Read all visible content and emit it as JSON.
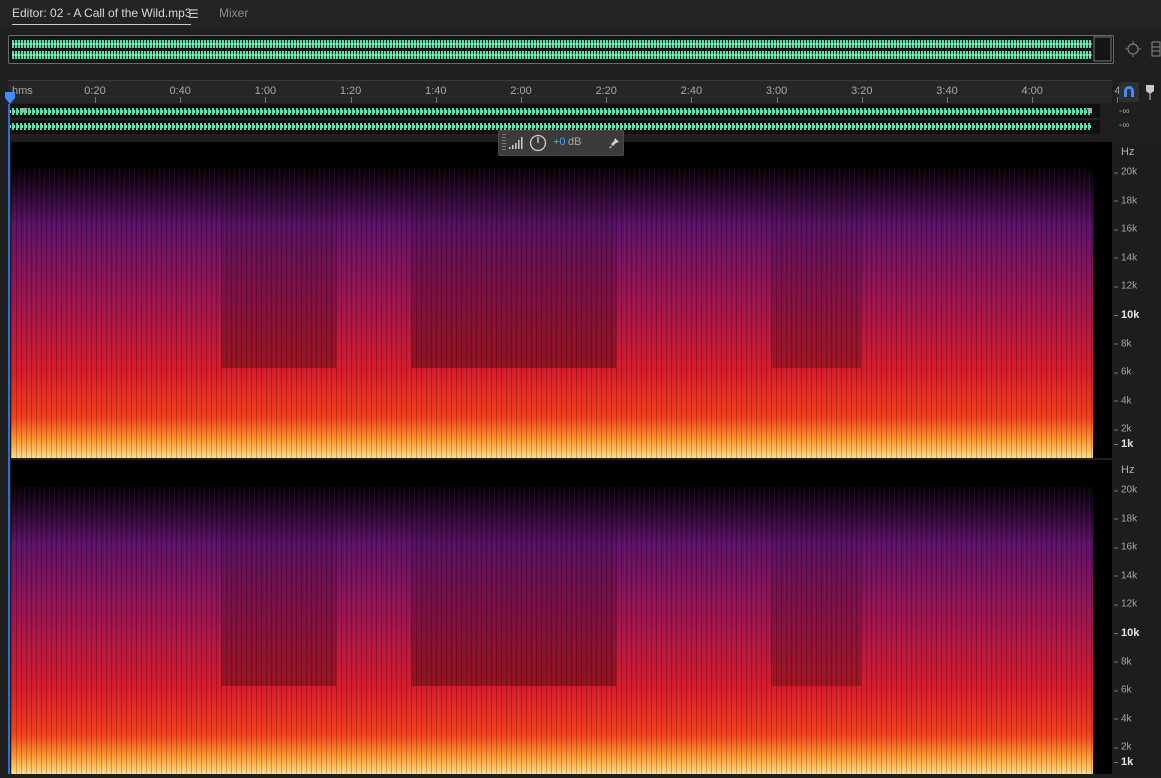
{
  "tabs": {
    "editor_label": "Editor: 02 - A Call of the Wild.mp3",
    "menu_glyph": "☰",
    "mixer_label": "Mixer"
  },
  "ruler": {
    "units": "hms",
    "ticks": [
      "0:20",
      "0:40",
      "1:00",
      "1:20",
      "1:40",
      "2:00",
      "2:20",
      "2:40",
      "3:00",
      "3:20",
      "3:40",
      "4:00",
      "4"
    ]
  },
  "levels": {
    "top": "-∞",
    "bottom": "-∞"
  },
  "hud": {
    "value": "+0",
    "unit": "dB"
  },
  "spectral": {
    "unit": "Hz",
    "freq_labels": [
      "20k",
      "18k",
      "16k",
      "14k",
      "12k",
      "10k",
      "8k",
      "6k",
      "4k",
      "2k",
      "1k"
    ],
    "bold_labels": [
      "10k",
      "1k"
    ]
  },
  "colors": {
    "waveform": "#4fe0a4",
    "accent": "#2c6fd8",
    "hud_value": "#4ea0ff",
    "spectrum_low": "#ffd66a",
    "spectrum_mid": "#e0202c",
    "spectrum_high": "#6a1478"
  },
  "icons": {
    "playhead": "playhead-icon",
    "snap": "snap-icon",
    "marker": "marker-icon",
    "zoom": "zoom-icon",
    "pin": "pin-icon",
    "knob": "volume-knob-icon"
  }
}
